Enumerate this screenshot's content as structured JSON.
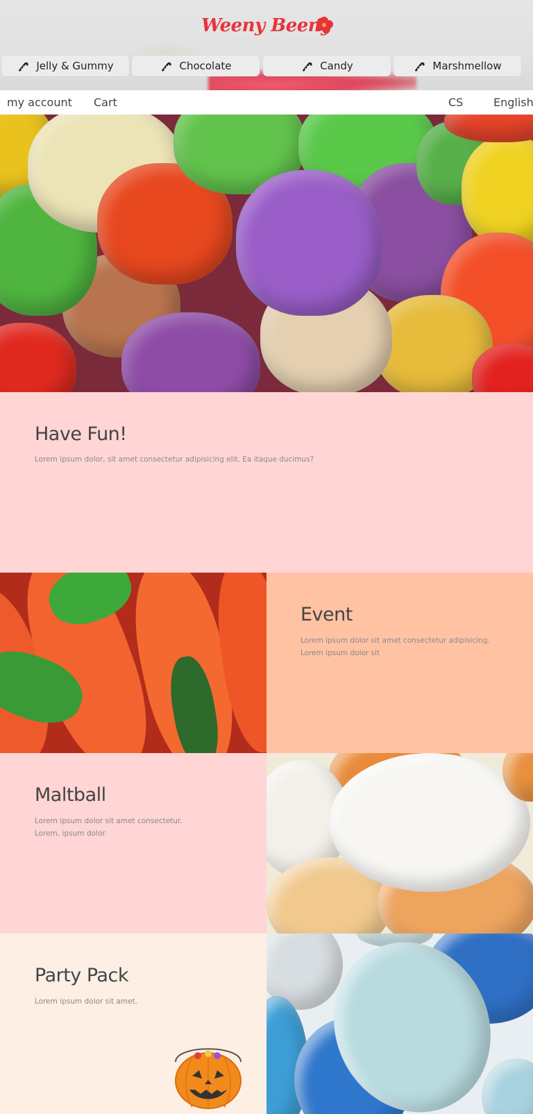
{
  "brand": {
    "logo_text": "Weeny Beeny",
    "color": "#e8333b"
  },
  "nav": {
    "items": [
      {
        "label": "Jelly & Gummy",
        "icon": "candy-cane-icon"
      },
      {
        "label": "Chocolate",
        "icon": "candy-cane-icon"
      },
      {
        "label": "Candy",
        "icon": "candy-cane-icon"
      },
      {
        "label": "Marshmellow",
        "icon": "candy-cane-icon"
      }
    ]
  },
  "topbar": {
    "my_account": "my account",
    "cart": "Cart",
    "cs": "CS",
    "language": "English"
  },
  "sections": {
    "fun": {
      "title": "Have Fun!",
      "text": "Lorem ipsum dolor, sit amet consectetur adipisicing elit. Ea itaque ducimus?"
    },
    "event": {
      "title": "Event",
      "line1": "Lorem ipsum dolor sit amet consectetur adipisicing.",
      "line2": "Lorem ipsum dolor sit"
    },
    "malt": {
      "title": "Maltball",
      "line1": "Lorem ipsum dolor sit amet consectetur.",
      "line2": "Lorem, ipsum dolor."
    },
    "party": {
      "title": "Party Pack",
      "text": "Lorem ipsum dolor sit amet."
    }
  },
  "colors": {
    "pink": "#ffd5d5",
    "peach": "#ffc3a4",
    "cream": "#feefe4"
  }
}
